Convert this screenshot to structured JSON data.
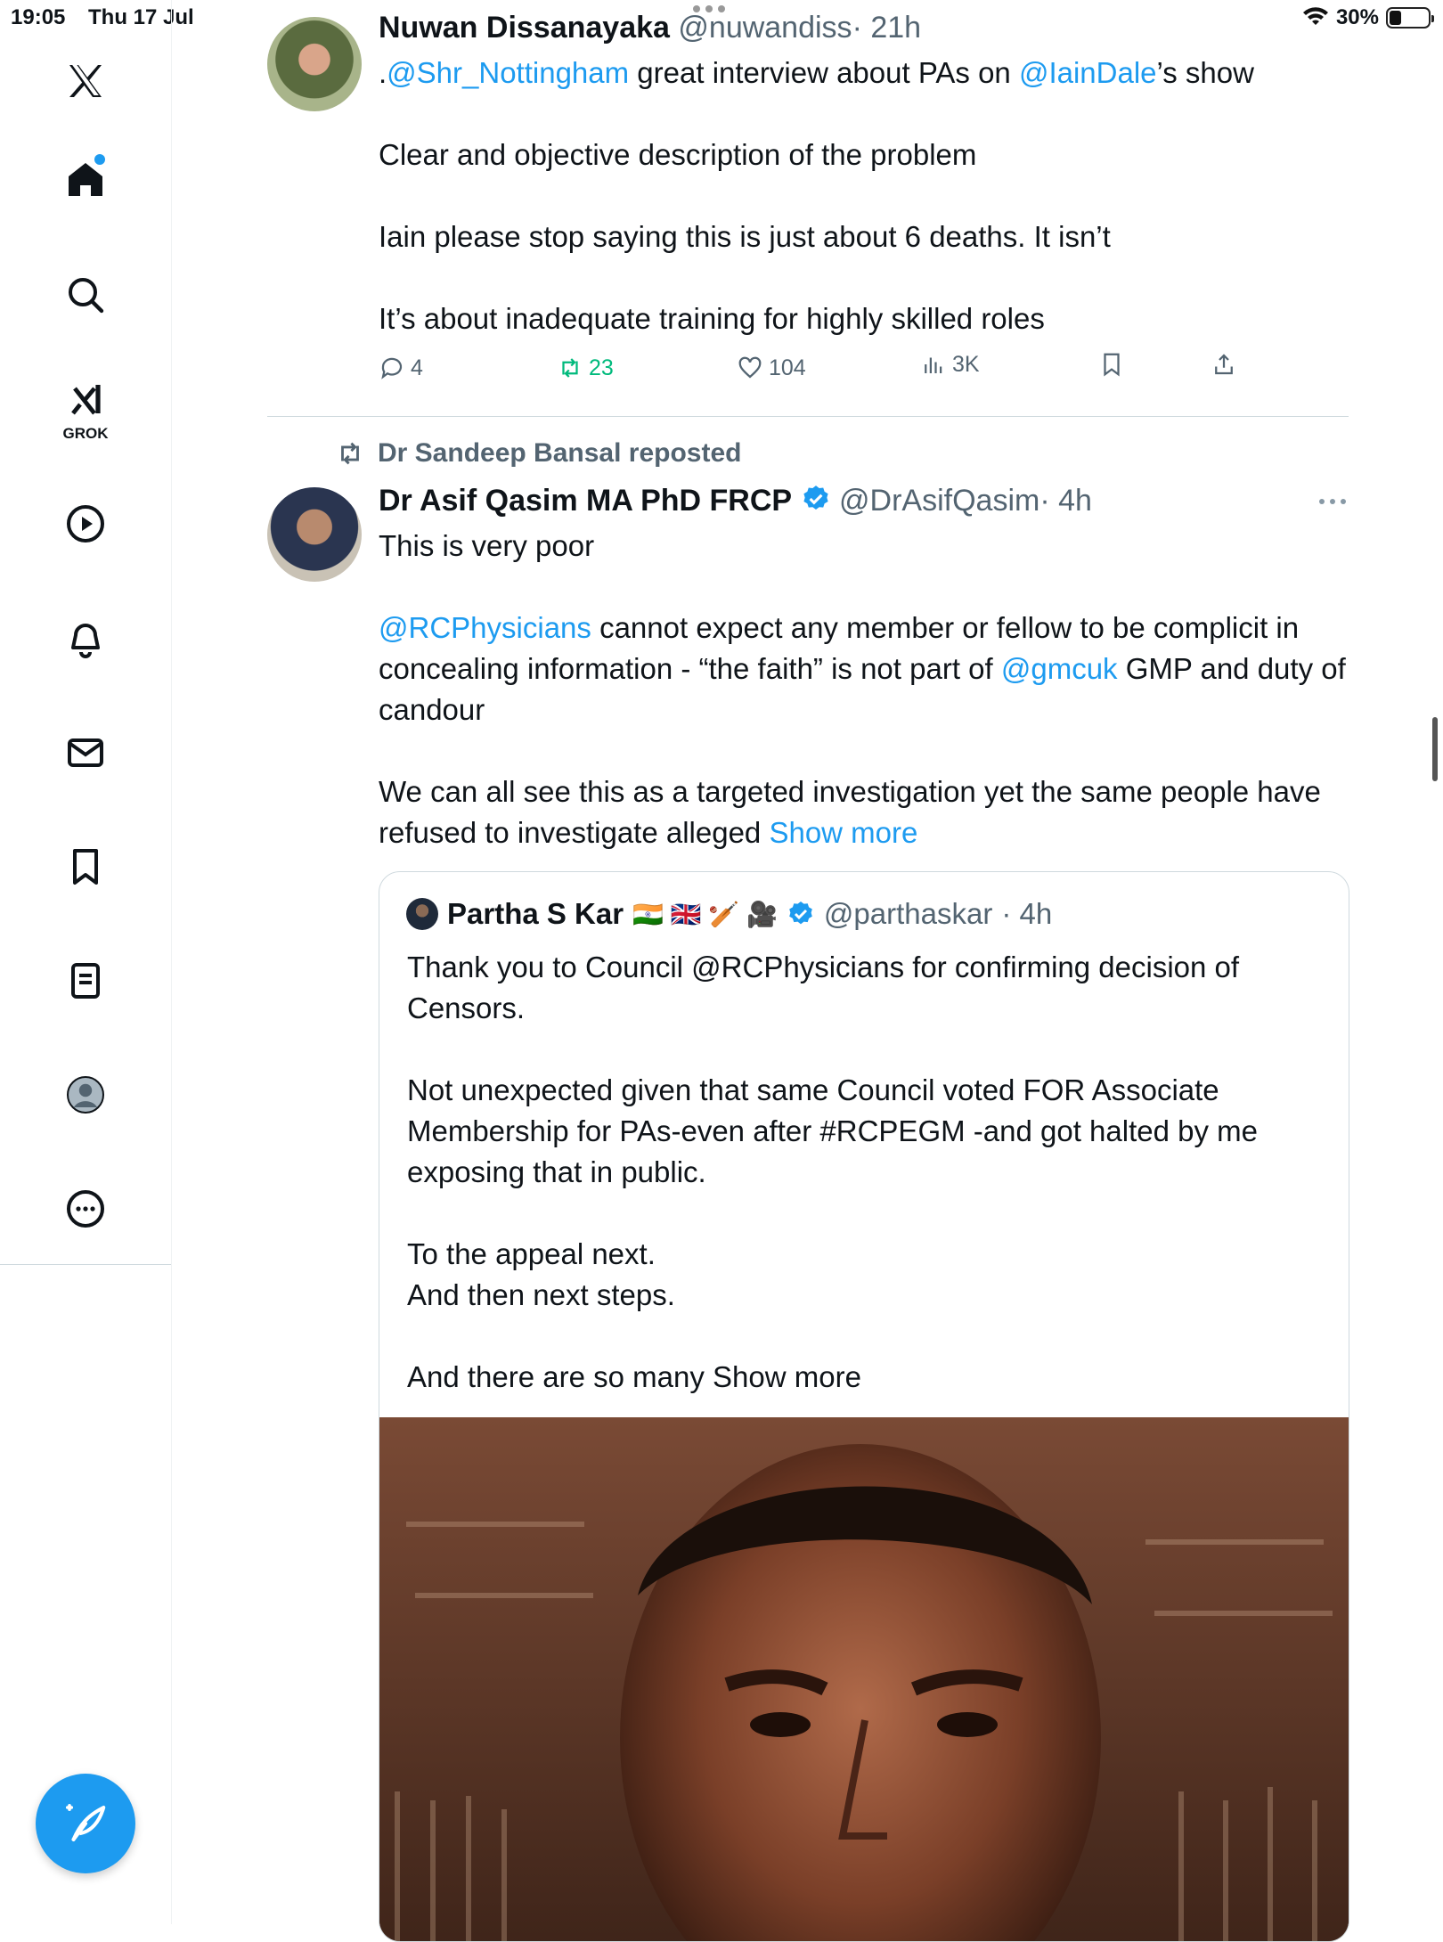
{
  "status_bar": {
    "time": "19:05",
    "date": "Thu 17 Jul",
    "battery_percent": "30%",
    "battery_level": 0.3
  },
  "sidebar": {
    "items": [
      {
        "name": "x-logo"
      },
      {
        "name": "home",
        "unread": true
      },
      {
        "name": "explore"
      },
      {
        "name": "grok",
        "label": "GROK"
      },
      {
        "name": "videos"
      },
      {
        "name": "notifications"
      },
      {
        "name": "messages"
      },
      {
        "name": "bookmarks"
      },
      {
        "name": "lists"
      },
      {
        "name": "profile"
      },
      {
        "name": "more"
      }
    ]
  },
  "tweet1": {
    "name": "Nuwan Dissanayaka",
    "handle": "@nuwandiss",
    "time": "· 21h",
    "text_part1": ".",
    "mention1": "@Shr_Nottingham",
    "text_part2": " great interview about PAs on ",
    "mention2": "@IainDale",
    "text_part3": "’s show\n\nClear and objective description of the problem\n\nIain please stop saying this is just about 6 deaths. It isn’t\n\nIt’s about inadequate training for highly skilled roles",
    "replies": "4",
    "reposts": "23",
    "likes": "104",
    "views": "3K"
  },
  "tweet2": {
    "repost_by": "Dr Sandeep Bansal reposted",
    "name": "Dr Asif Qasim MA PhD FRCP",
    "handle": "@DrAsifQasim",
    "time": "· 4h",
    "text_part1": "This is very poor\n\n",
    "mention1": "@RCPhysicians",
    "text_part2": " cannot expect any member or fellow to be complicit in concealing information - “the faith” is not part of ",
    "mention2": "@gmcuk",
    "text_part3": " GMP and duty of candour\n\nWe can all see this as a targeted investigation yet the same people have refused to investigate alleged ",
    "show_more": "Show more",
    "quote": {
      "name": "Partha S Kar",
      "flags": "🇮🇳 🇬🇧 🏏 🎥",
      "handle": "@parthaskar",
      "time": "· 4h",
      "text": "Thank you to Council @RCPhysicians for confirming decision of Censors.\n\nNot unexpected given that same Council voted FOR Associate Membership for PAs-even after #RCPEGM -and got halted by me exposing that in public.\n\nTo the appeal next.\nAnd then next steps.\n\nAnd there are so many ",
      "show_more": "Show more"
    }
  },
  "colors": {
    "accent": "#1d9bf0",
    "text": "#0f1419",
    "secondary": "#536471",
    "repost_green": "#00ba7c"
  }
}
